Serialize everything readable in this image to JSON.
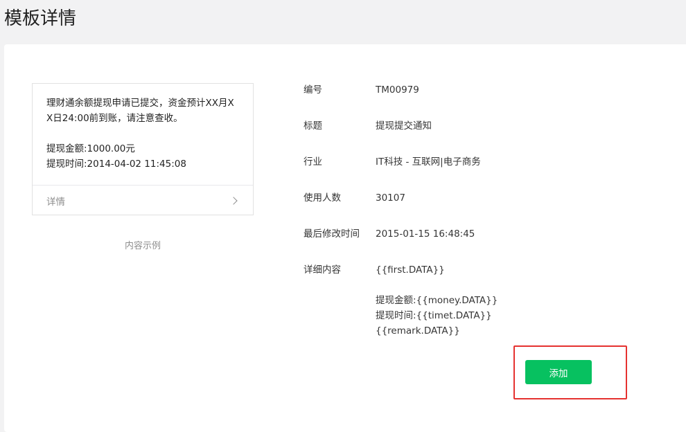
{
  "page": {
    "title": "模板详情"
  },
  "preview": {
    "first": "理财通余额提现申请已提交，资金预计XX月XX日24:00前到账，请注意查收。",
    "lines": [
      "提现金额:1000.00元",
      "提现时间:2014-04-02 11:45:08"
    ],
    "footer_label": "详情",
    "caption": "内容示例"
  },
  "details": {
    "id_label": "编号",
    "id_value": "TM00979",
    "title_label": "标题",
    "title_value": "提现提交通知",
    "industry_label": "行业",
    "industry_value": "IT科技 - 互联网|电子商务",
    "users_label": "使用人数",
    "users_value": "30107",
    "modified_label": "最后修改时间",
    "modified_value": "2015-01-15 16:48:45",
    "content_label": "详细内容",
    "content_first": "{{first.DATA}}",
    "content_lines": [
      "提现金额:{{money.DATA}}",
      "提现时间:{{timet.DATA}}",
      "{{remark.DATA}}"
    ]
  },
  "actions": {
    "add_label": "添加"
  },
  "colors": {
    "accent": "#07c160",
    "highlight": "#e5312f",
    "background": "#f2f2f3"
  }
}
